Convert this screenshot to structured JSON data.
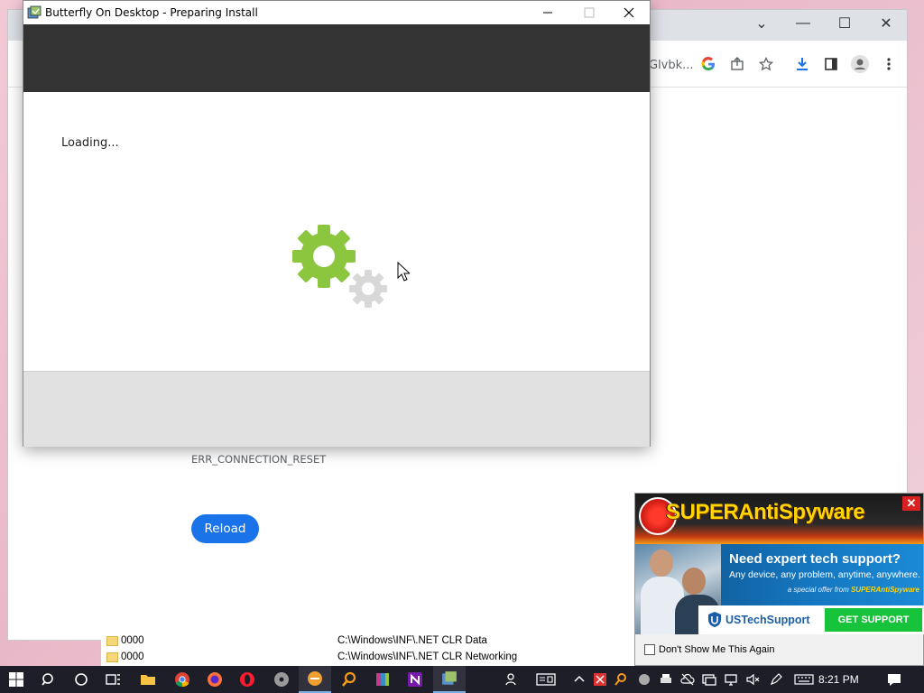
{
  "chrome": {
    "omnibox_text": "Glvbk...",
    "error_code": "ERR_CONNECTION_RESET",
    "reload_label": "Reload"
  },
  "explorer": {
    "rows": [
      {
        "name": "0000",
        "path": "C:\\Windows\\INF\\.NET CLR Data"
      },
      {
        "name": "0000",
        "path": "C:\\Windows\\INF\\.NET CLR Networking"
      }
    ]
  },
  "installer": {
    "title": "Butterfly On Desktop - Preparing Install",
    "loading_text": "Loading...",
    "gear_primary_color": "#8cc63f",
    "gear_secondary_color": "#d8d8d8",
    "header_color": "#333333"
  },
  "popup": {
    "brand": "SUPERAntiSpyware",
    "headline": "Need expert tech support?",
    "subline": "Any device, any problem, anytime, anywhere.",
    "offer_prefix": "a special offer from",
    "offer_brand": "SUPERAntiSpyware",
    "partner": "USTechSupport",
    "cta": "GET SUPPORT",
    "dont_show": "Don't Show Me This Again",
    "close_glyph": "✕"
  },
  "taskbar": {
    "time": "8:21 PM"
  }
}
